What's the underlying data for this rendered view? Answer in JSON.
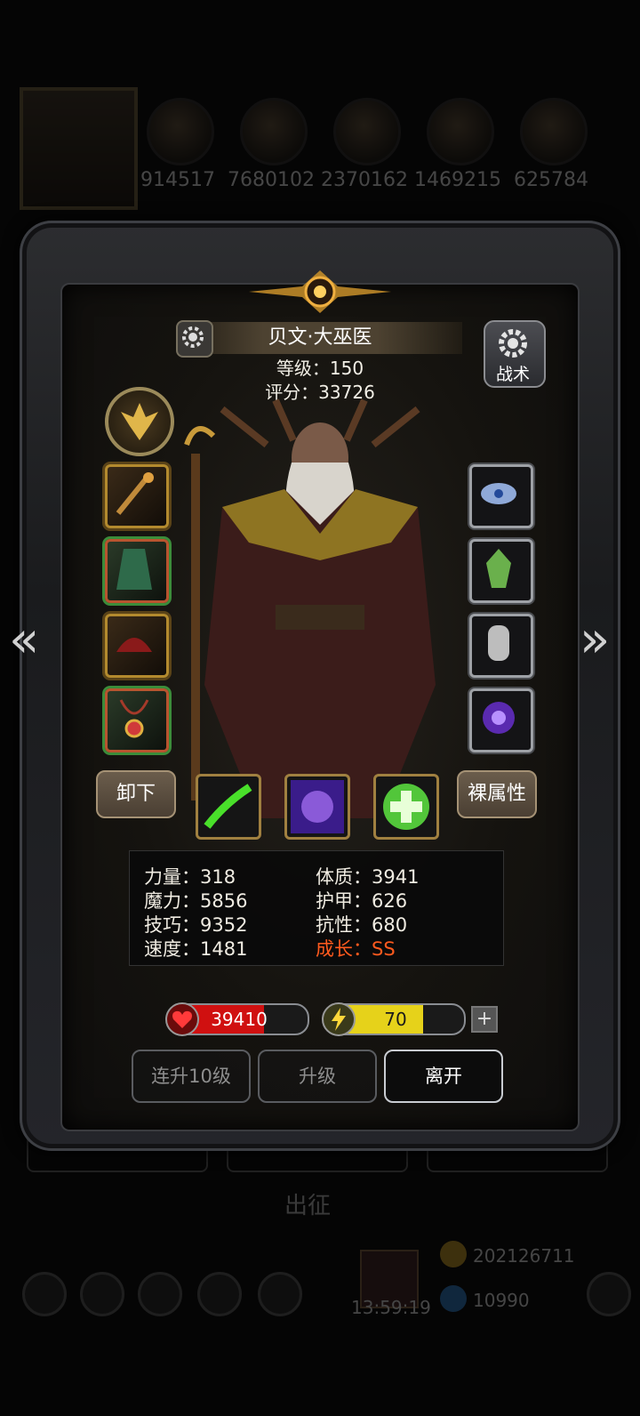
{
  "background": {
    "resources": [
      "914517",
      "7680102",
      "2370162",
      "1469215",
      "625784"
    ],
    "tabs": [
      "",
      "",
      ""
    ],
    "depart_label": "出征",
    "diamond_value": "202126711",
    "timer": "13:59:19",
    "gold_value": "10990"
  },
  "hero": {
    "name": "贝文·大巫医",
    "level_line": "等级：150",
    "score_line": "评分：33726",
    "tactics_label": "战术",
    "unequip_label": "卸下",
    "base_attr_label": "裸属性"
  },
  "stats": {
    "strength": "力量：318",
    "magic": "魔力：5856",
    "skill": "技巧：9352",
    "speed": "速度：1481",
    "constitution": "体质：3941",
    "armor": "护甲：626",
    "resistance": "抗性：680",
    "growth": "成长：SS"
  },
  "bars": {
    "hp_value": "39410",
    "hp_fill": 0.68,
    "energy_value": "70",
    "energy_fill": 0.7
  },
  "actions": {
    "level10_label": "连升10级",
    "levelup_label": "升级",
    "leave_label": "离开"
  },
  "colors": {
    "growth": "#ff5a1e",
    "hp": "#d01010",
    "energy": "#e6d21a"
  },
  "icons": {
    "left_arrow": "double-chevron-left-icon",
    "right_arrow": "double-chevron-right-icon",
    "hp_icon": "heart-icon",
    "energy_icon": "lightning-icon"
  }
}
